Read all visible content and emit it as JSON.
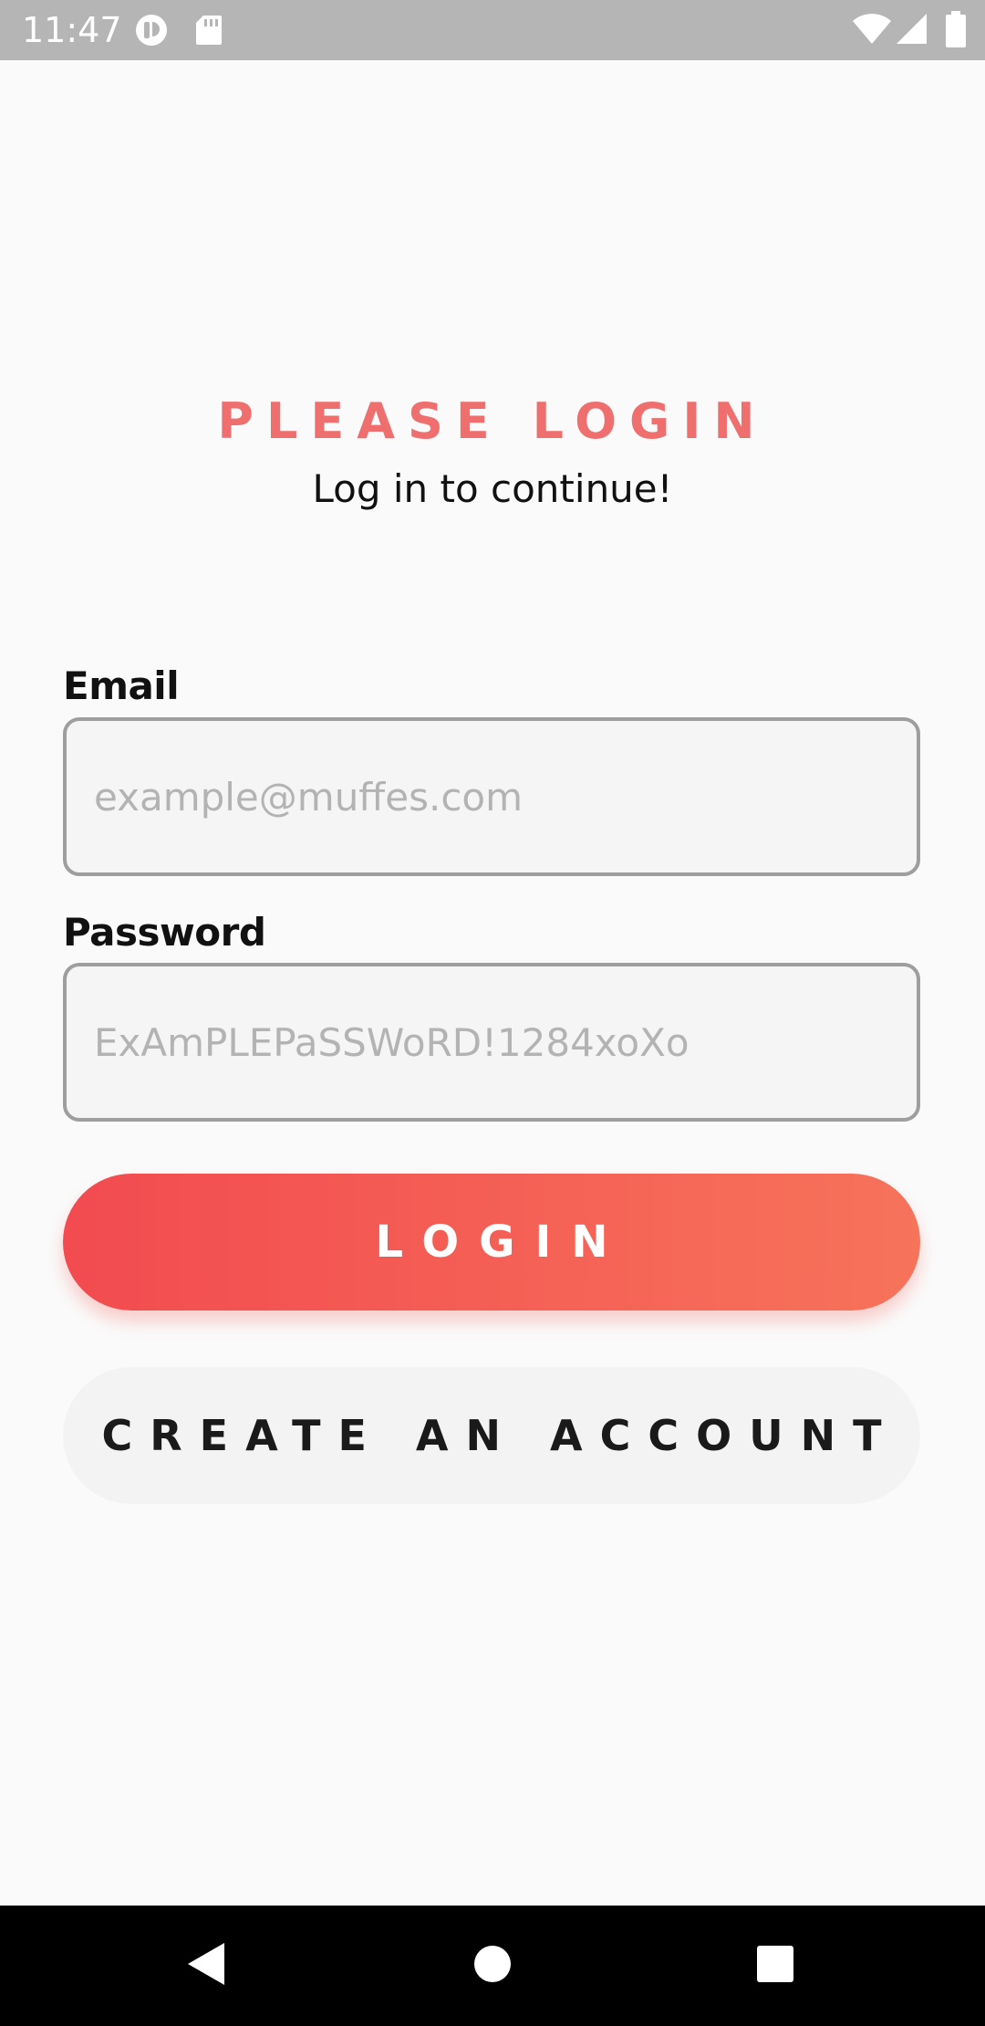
{
  "status_bar": {
    "time": "11:47",
    "icons": [
      "notification-icon",
      "sd-card-icon",
      "wifi-icon",
      "cell-signal-icon",
      "battery-icon"
    ]
  },
  "header": {
    "title": "PLEASE LOGIN",
    "subtitle": "Log in to continue!"
  },
  "form": {
    "email": {
      "label": "Email",
      "placeholder": "example@muffes.com"
    },
    "password": {
      "label": "Password",
      "placeholder": "ExAmPLEPaSSWoRD!1284xoXo"
    }
  },
  "buttons": {
    "login_label": "LOGIN",
    "create_account_label": "CREATE AN ACCOUNT"
  },
  "colors": {
    "accent": "#ef6e6e",
    "login_gradient_start": "#f24b50",
    "login_gradient_end": "#f7735a",
    "background": "#fafafa",
    "status_bar": "#b5b5b5"
  },
  "nav_bar": {
    "icons": [
      "back-icon",
      "home-icon",
      "recents-icon"
    ]
  }
}
